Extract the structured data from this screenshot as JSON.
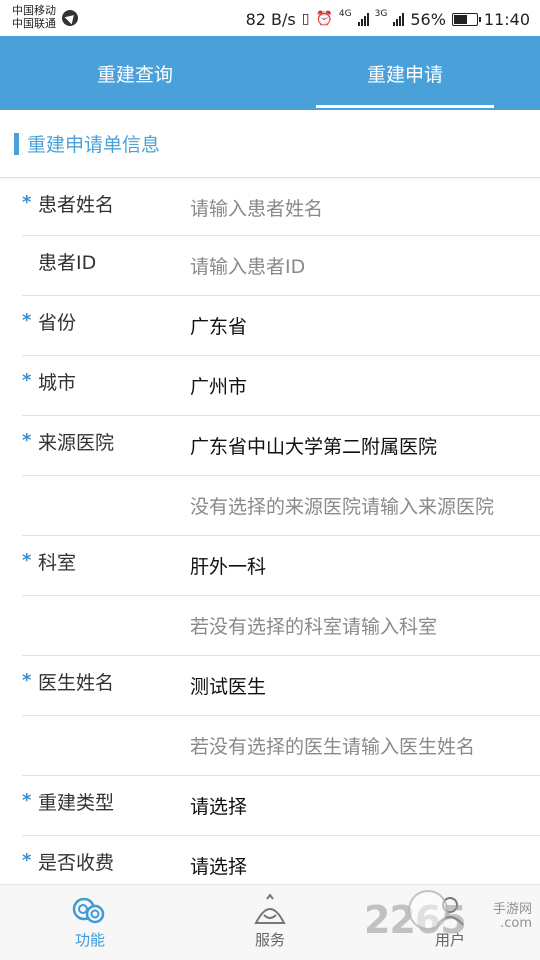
{
  "status_bar": {
    "carrier_1": "中国移动",
    "carrier_2": "中国联通",
    "net_speed": "82 B/s",
    "net_1": "4G",
    "net_2": "3G",
    "battery": "56%",
    "time": "11:40"
  },
  "tabs": [
    {
      "label": "重建查询",
      "active": false
    },
    {
      "label": "重建申请",
      "active": true
    }
  ],
  "section_title": "重建申请单信息",
  "form": {
    "required_mark": "*",
    "rows": [
      {
        "label": "患者姓名",
        "required": true,
        "value": "",
        "placeholder": "请输入患者姓名"
      },
      {
        "label": "患者ID",
        "required": false,
        "value": "",
        "placeholder": "请输入患者ID"
      },
      {
        "label": "省份",
        "required": true,
        "value": "广东省",
        "placeholder": ""
      },
      {
        "label": "城市",
        "required": true,
        "value": "广州市",
        "placeholder": ""
      },
      {
        "label": "来源医院",
        "required": true,
        "value": "广东省中山大学第二附属医院",
        "placeholder": ""
      },
      {
        "label": "",
        "required": false,
        "value": "",
        "placeholder": "没有选择的来源医院请输入来源医院"
      },
      {
        "label": "科室",
        "required": true,
        "value": "肝外一科",
        "placeholder": ""
      },
      {
        "label": "",
        "required": false,
        "value": "",
        "placeholder": "若没有选择的科室请输入科室"
      },
      {
        "label": "医生姓名",
        "required": true,
        "value": "测试医生",
        "placeholder": ""
      },
      {
        "label": "",
        "required": false,
        "value": "",
        "placeholder": "若没有选择的医生请输入医生姓名"
      },
      {
        "label": "重建类型",
        "required": true,
        "value": "请选择",
        "placeholder": ""
      },
      {
        "label": "是否收费",
        "required": true,
        "value": "请选择",
        "placeholder": ""
      }
    ]
  },
  "bottom_nav": [
    {
      "label": "功能",
      "icon": "function-icon",
      "active": true
    },
    {
      "label": "服务",
      "icon": "service-icon",
      "active": false
    },
    {
      "label": "用户",
      "icon": "user-icon",
      "active": false
    }
  ],
  "watermark": {
    "number": "2265",
    "domain": ".com",
    "site": "手游网"
  },
  "colors": {
    "accent": "#4aa1d9",
    "required": "#3a8fd0",
    "nav_active": "#3d9bd8"
  }
}
